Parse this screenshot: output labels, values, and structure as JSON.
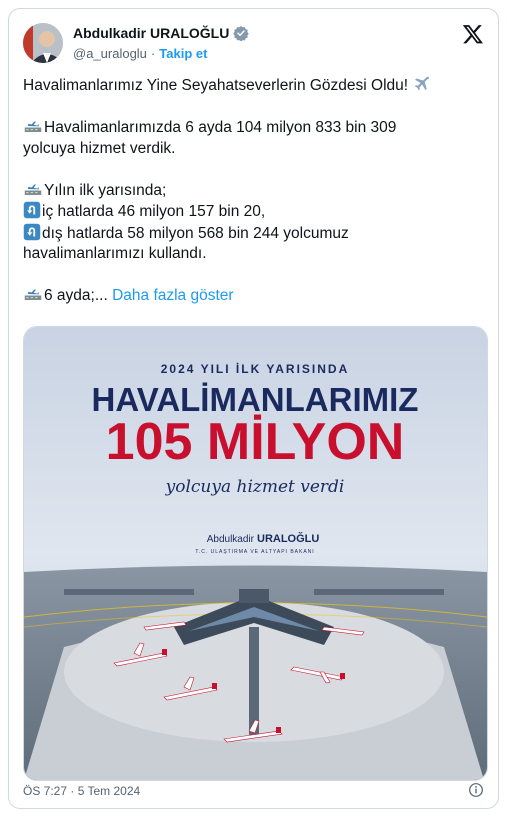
{
  "author": {
    "name": "Abdulkadir URALOĞLU",
    "handle": "@a_uraloglu",
    "separator": "·",
    "follow_label": "Takip et"
  },
  "tweet": {
    "line1": "Havalimanlarımız Yine Seyahatseverlerin Gözdesi Oldu!",
    "line2a": "Havalimanlarımızda 6 ayda 104 milyon 833 bin 309",
    "line2b": "yolcuya hizmet verdik.",
    "line3": "Yılın ilk yarısında;",
    "line4": "iç hatlarda 46 milyon 157 bin 20,",
    "line5": "dış hatlarda 58 milyon 568 bin 244 yolcumuz",
    "line6": "havalimanlarımızı kullandı.",
    "line7": "6 ayda;...",
    "show_more": "Daha fazla göster"
  },
  "media": {
    "kicker": "2024 YILI İLK YARISINDA",
    "headline": "HAVALİMANLARIMIZ",
    "big_number": "105 MİLYON",
    "script_text": "yolcuya hizmet verdi",
    "signature_first": "Abdulkadir",
    "signature_last": "URALOĞLU",
    "signature_title": "T.C. ULAŞTIRMA VE ALTYAPI BAKANI"
  },
  "footer": {
    "timestamp": "ÖS 7:27 · 5 Tem 2024"
  },
  "colors": {
    "accent": "#1d9bf0",
    "headline_navy": "#1a2a5e",
    "number_red": "#c8102e",
    "sky_top": "#c9d3e3"
  },
  "icons": [
    "verified-badge-icon",
    "x-logo-icon",
    "airplane-icon",
    "airport-emoji-icon",
    "u-turn-arrow-icon",
    "info-icon"
  ]
}
